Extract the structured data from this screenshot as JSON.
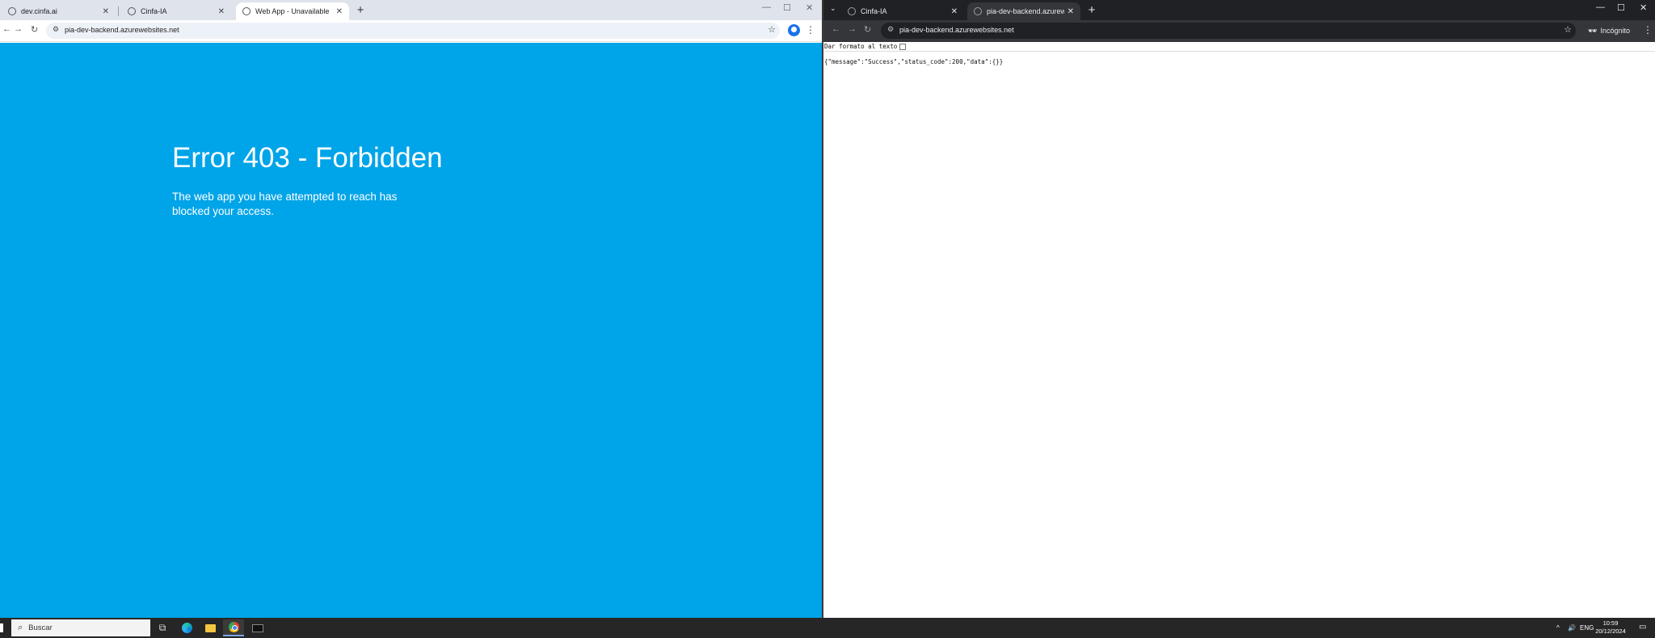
{
  "left_window": {
    "tabs": [
      {
        "label": "dev.cinfa.ai",
        "close": "✕",
        "active": false
      },
      {
        "label": "Cinfa-IA",
        "close": "✕",
        "active": false
      },
      {
        "label": "Web App - Unavailable",
        "close": "✕",
        "active": true
      }
    ],
    "new_tab": "+",
    "controls": {
      "minimize": "—",
      "maximize": "☐",
      "close": "✕"
    },
    "url": "pia-dev-backend.azurewebsites.net",
    "page": {
      "title": "Error 403 - Forbidden",
      "message": "The web app you have attempted to reach has blocked your access.",
      "background": "#00a4e8"
    }
  },
  "right_window": {
    "tabs": [
      {
        "label": "Cinfa-IA",
        "close": "✕",
        "active": false
      },
      {
        "label": "pia-dev-backend.azurewebsite",
        "close": "✕",
        "active": true
      }
    ],
    "new_tab": "+",
    "controls": {
      "minimize": "—",
      "maximize": "☐",
      "close": "✕"
    },
    "url": "pia-dev-backend.azurewebsites.net",
    "incognito_label": "Incógnito",
    "page": {
      "format_label": "Dar formato al texto",
      "format_checked": false,
      "json_text": "{\"message\":\"Success\",\"status_code\":200,\"data\":{}}"
    }
  },
  "taskbar": {
    "search_placeholder": "Buscar",
    "apps": [
      "task-view",
      "edge",
      "file-explorer",
      "chrome",
      "terminal"
    ],
    "tray": {
      "language": "ENG",
      "time": "10:59",
      "date": "20/12/2024"
    }
  },
  "colors": {
    "error_blue": "#00a4e8",
    "incognito_dark": "#202124",
    "taskbar": "#262626"
  }
}
